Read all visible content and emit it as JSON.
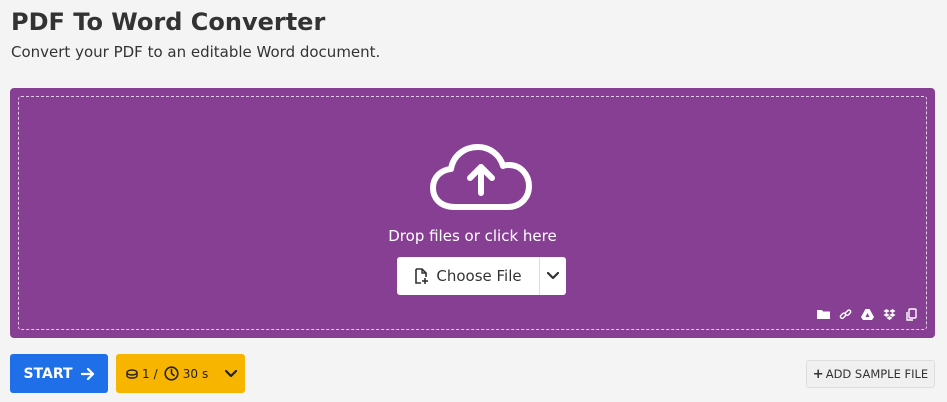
{
  "header": {
    "title": "PDF To Word Converter",
    "subtitle": "Convert your PDF to an editable Word document."
  },
  "upload": {
    "drop_text": "Drop files or click here",
    "choose_label": "Choose File",
    "source_icons": [
      "folder-icon",
      "link-icon",
      "google-drive-icon",
      "dropbox-icon",
      "clipboard-icon"
    ],
    "background_color": "#873f94"
  },
  "actions": {
    "start_label": "START",
    "credits_count": "1",
    "credits_sep": "/",
    "credits_time_value": "30",
    "credits_time_unit": "s",
    "add_sample_label": "ADD SAMPLE FILE",
    "start_color": "#1f6fe8",
    "credits_color": "#f7b500"
  }
}
